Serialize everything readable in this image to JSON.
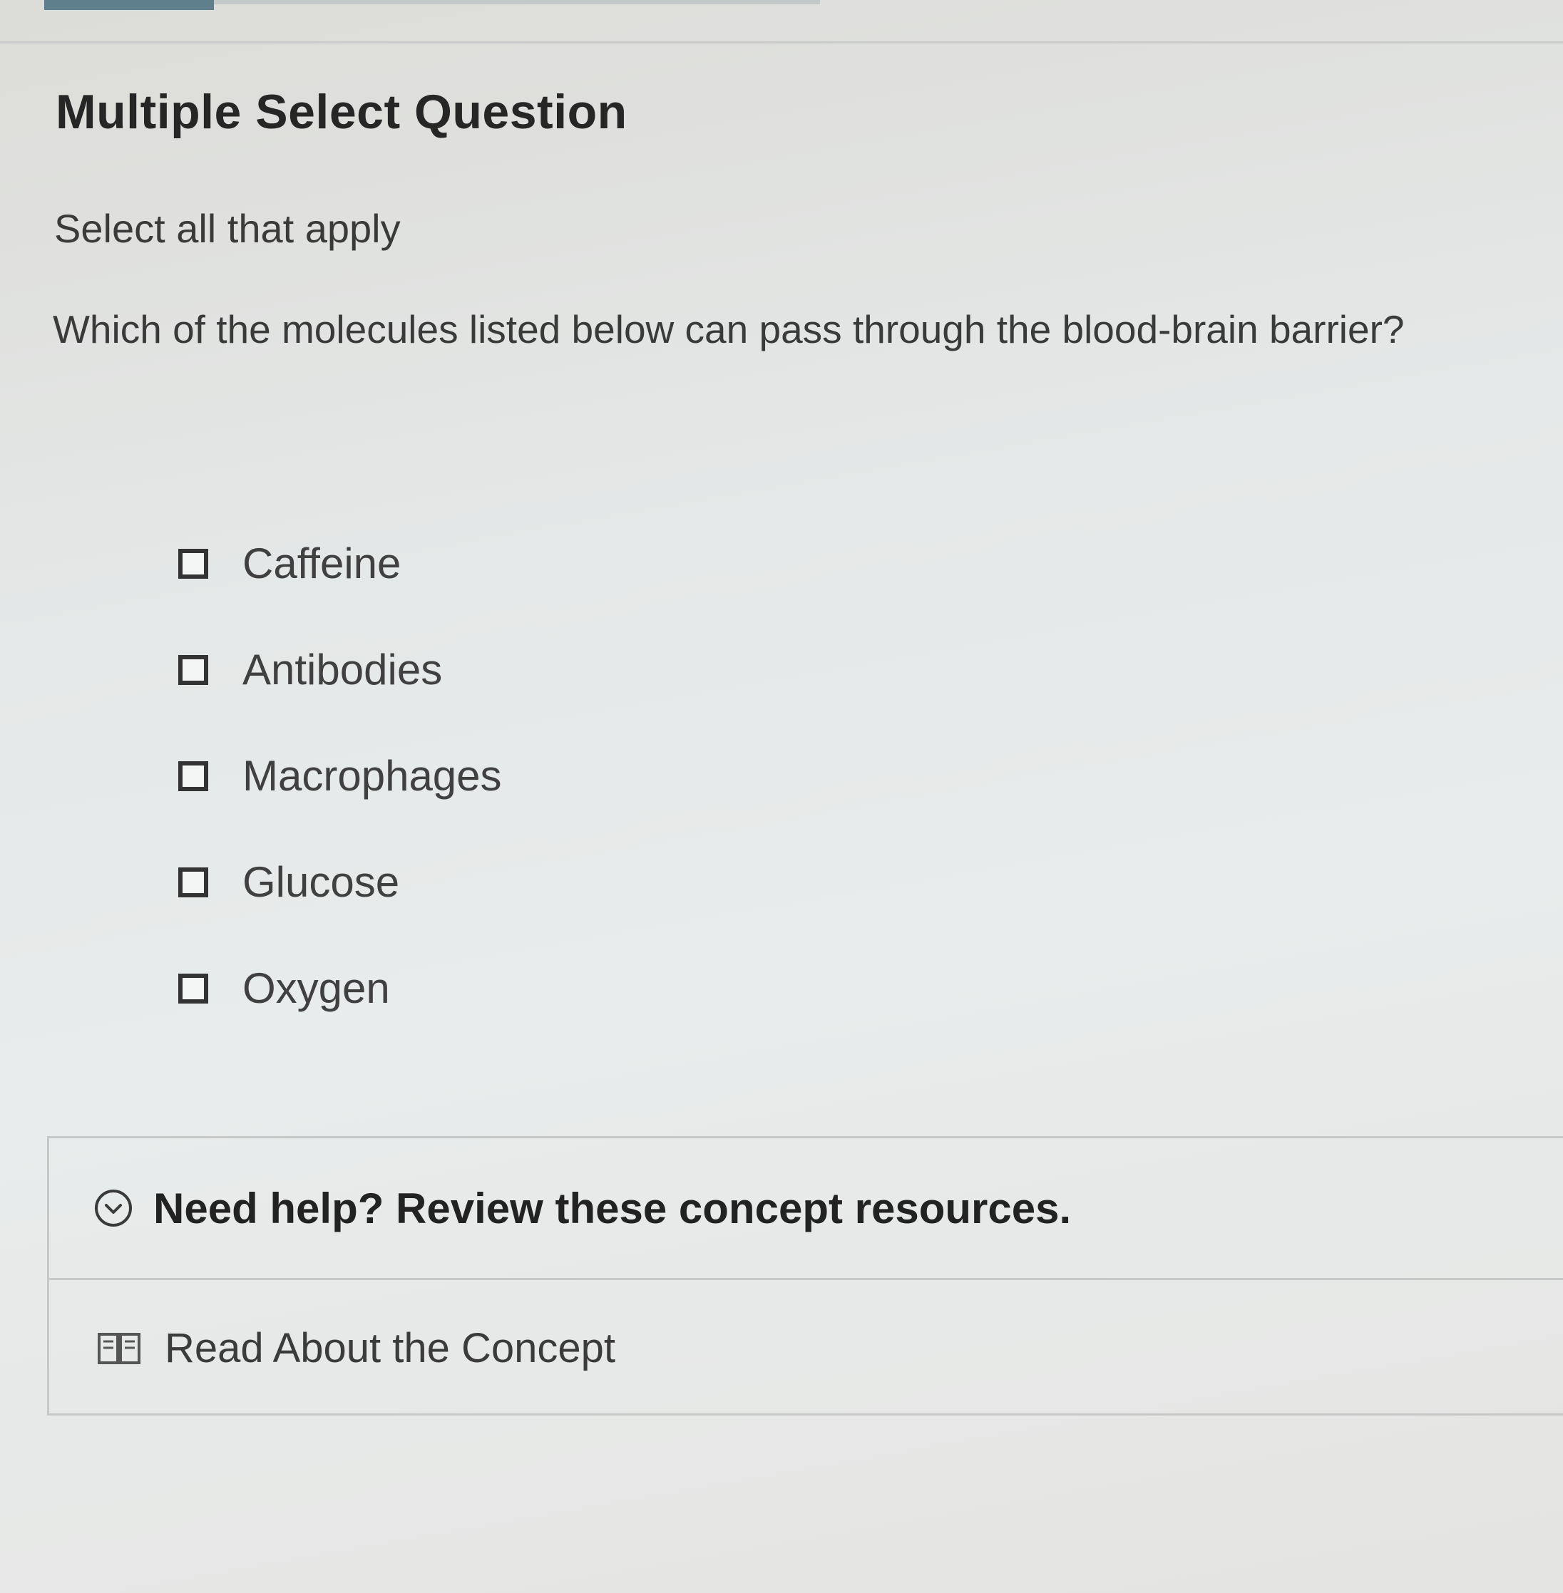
{
  "question": {
    "type_label": "Multiple Select Question",
    "instruction": "Select all that apply",
    "prompt": "Which of the molecules listed below can pass through the blood-brain barrier?"
  },
  "options": [
    {
      "label": "Caffeine",
      "checked": false
    },
    {
      "label": "Antibodies",
      "checked": false
    },
    {
      "label": "Macrophages",
      "checked": false
    },
    {
      "label": "Glucose",
      "checked": false
    },
    {
      "label": "Oxygen",
      "checked": false
    }
  ],
  "help": {
    "toggle_label": "Need help? Review these concept resources.",
    "toggle_icon": "chevron-down-circle-icon",
    "resource_label": "Read About the Concept",
    "resource_icon": "book-icon"
  },
  "colors": {
    "accent": "#5f7f8c",
    "text": "#262626"
  }
}
